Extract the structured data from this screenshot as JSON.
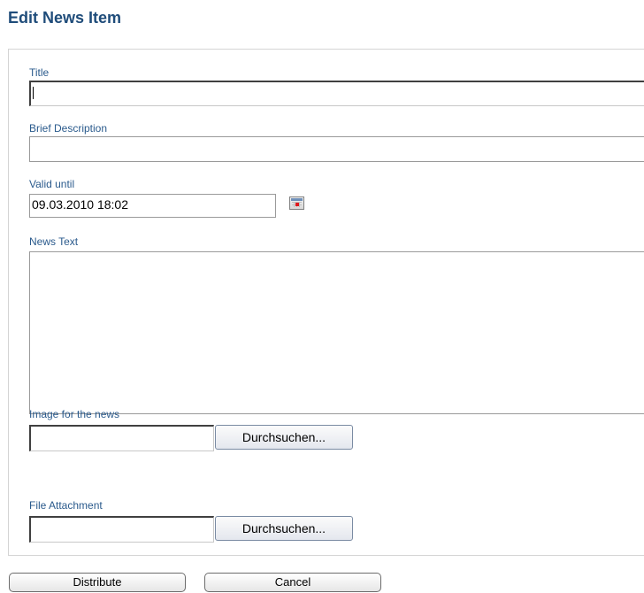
{
  "page": {
    "title": "Edit News Item"
  },
  "form": {
    "title": {
      "label": "Title",
      "value": ""
    },
    "brief_description": {
      "label": "Brief Description",
      "value": ""
    },
    "valid_until": {
      "label": "Valid until",
      "value": "09.03.2010 18:02",
      "calendar_icon": "calendar-icon"
    },
    "news_text": {
      "label": "News Text",
      "value": ""
    },
    "image": {
      "label": "Image for the news",
      "value": "",
      "browse_label": "Durchsuchen..."
    },
    "attachment": {
      "label": "File Attachment",
      "value": "",
      "browse_label": "Durchsuchen..."
    }
  },
  "actions": {
    "distribute_label": "Distribute",
    "cancel_label": "Cancel"
  },
  "colors": {
    "title": "#1f4c7a",
    "label": "#2a5a8c"
  }
}
